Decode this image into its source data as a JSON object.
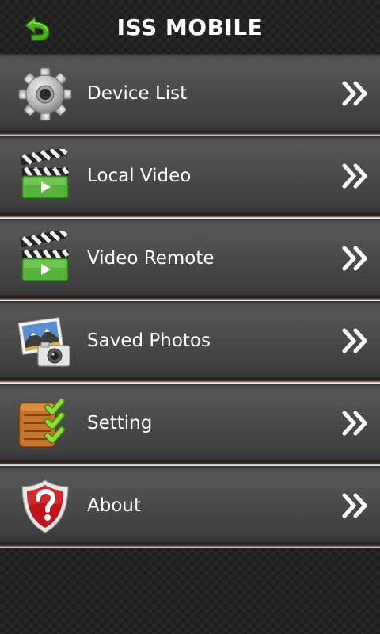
{
  "header": {
    "title": "ISS MOBILE",
    "back_icon": "back-arrow-icon"
  },
  "colors": {
    "back_arrow": "#4caf1a",
    "title_text": "#ffffff",
    "item_text": "#ffffff",
    "chevron": "#ffffff"
  },
  "menu": {
    "items": [
      {
        "label": "Device List",
        "icon": "gear-icon"
      },
      {
        "label": "Local Video",
        "icon": "clapperboard-icon"
      },
      {
        "label": "Video Remote",
        "icon": "clapperboard-icon"
      },
      {
        "label": "Saved Photos",
        "icon": "photos-camera-icon"
      },
      {
        "label": "Setting",
        "icon": "checklist-box-icon"
      },
      {
        "label": "About",
        "icon": "question-shield-icon"
      }
    ],
    "chevron_icon": "double-chevron-right-icon"
  }
}
